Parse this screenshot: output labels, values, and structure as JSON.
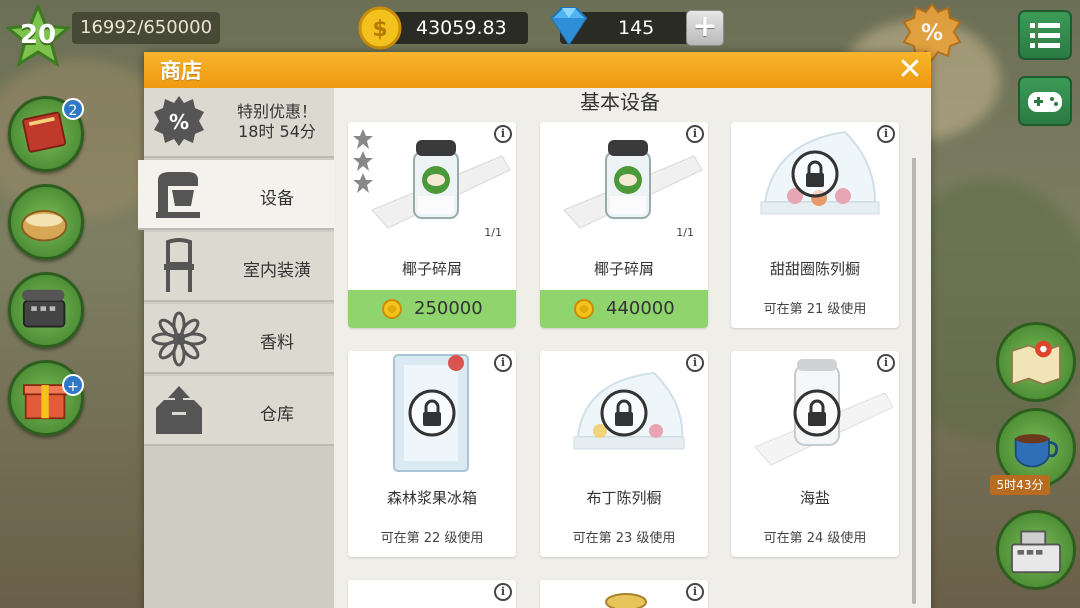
{
  "hud": {
    "level": "20",
    "xp": "16992/650000",
    "coins": "43059.83",
    "gems": "145",
    "add_label": "+"
  },
  "side_buttons": {
    "recipes_badge": "2",
    "gift_badge": "+"
  },
  "right_buttons": {
    "coffee_timer": "5时43分"
  },
  "shop": {
    "title": "商店",
    "close_label": "✕",
    "section_title": "基本设备",
    "categories": [
      {
        "label": "特别优惠！\n18时 54分",
        "icon": "percent-icon"
      },
      {
        "label": "设备",
        "icon": "stand-mixer-icon"
      },
      {
        "label": "室内装潢",
        "icon": "chair-icon"
      },
      {
        "label": "香料",
        "icon": "star-anise-icon"
      },
      {
        "label": "仓库",
        "icon": "box-icon"
      }
    ],
    "special_offer_line1": "特别优惠！",
    "special_offer_line2": "18时 54分",
    "items": [
      {
        "name": "椰子碎屑",
        "price": "250000",
        "count": "1/1",
        "locked": false
      },
      {
        "name": "椰子碎屑",
        "price": "440000",
        "count": "1/1",
        "locked": false
      },
      {
        "name": "甜甜圈陈列橱",
        "req": "可在第 21 级使用",
        "locked": true
      },
      {
        "name": "森林浆果冰箱",
        "req": "可在第 22 级使用",
        "locked": true
      },
      {
        "name": "布丁陈列橱",
        "req": "可在第 23 级使用",
        "locked": true
      },
      {
        "name": "海盐",
        "req": "可在第 24 级使用",
        "locked": true
      }
    ]
  },
  "colors": {
    "header": "#f4a61e",
    "price_bg": "#8fd46c",
    "hud_green": "#3c9b57"
  }
}
